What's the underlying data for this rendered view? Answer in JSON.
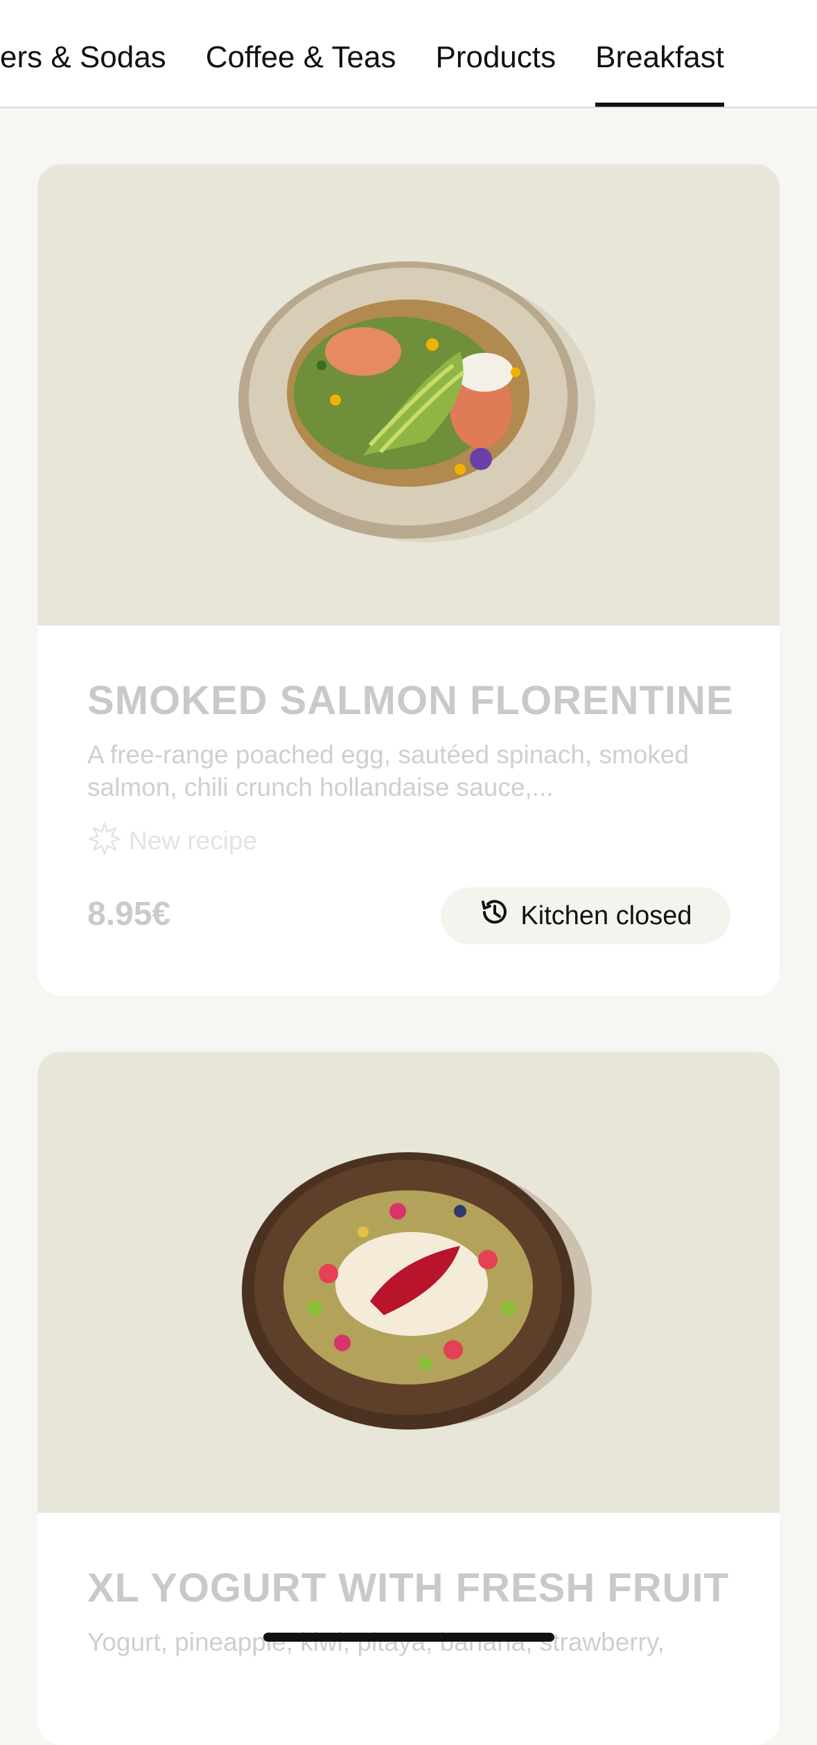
{
  "nav": {
    "tabs": [
      {
        "label": "kers & Sodas",
        "active": false
      },
      {
        "label": "Coffee & Teas",
        "active": false
      },
      {
        "label": "Products",
        "active": false
      },
      {
        "label": "Breakfast",
        "active": true
      }
    ]
  },
  "items": [
    {
      "title": "SMOKED SALMON FLORENTINE",
      "description": "A free-range poached egg, sautéed spinach, smoked salmon, chili crunch hollandaise sauce,...",
      "badge_icon": "sparkle-icon",
      "badge": "New recipe",
      "price": "8.95€",
      "status_icon": "history-clock-icon",
      "status": "Kitchen closed"
    },
    {
      "title": "XL YOGURT WITH FRESH FRUIT",
      "description": "Yogurt, pineapple, kiwi, pitaya, banana, strawberry,"
    }
  ]
}
